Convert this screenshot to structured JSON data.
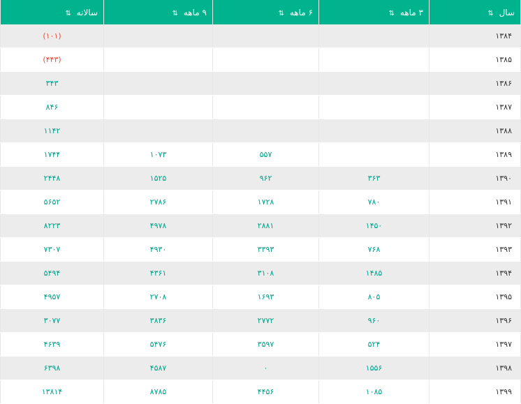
{
  "headers": {
    "annual": "سالانه",
    "nine_month": "۹ ماهه",
    "six_month": "۶ ماهه",
    "three_month": "۳ ماهه",
    "year": "سال",
    "sort_icon": "⇅",
    "sort_active_icon": "⇅"
  },
  "colors": {
    "header_bg": "#00b38f",
    "value_text": "#00a189",
    "negative_text": "#e74c3c",
    "row_alt_bg": "#ececec"
  },
  "rows": [
    {
      "year": "۱۳۸۴",
      "m3": "",
      "m6": "",
      "m9": "",
      "annual": "(۱۰۱)",
      "negative": true
    },
    {
      "year": "۱۳۸۵",
      "m3": "",
      "m6": "",
      "m9": "",
      "annual": "(۴۴۳)",
      "negative": true
    },
    {
      "year": "۱۳۸۶",
      "m3": "",
      "m6": "",
      "m9": "",
      "annual": "۳۴۳",
      "negative": false
    },
    {
      "year": "۱۳۸۷",
      "m3": "",
      "m6": "",
      "m9": "",
      "annual": "۸۴۶",
      "negative": false
    },
    {
      "year": "۱۳۸۸",
      "m3": "",
      "m6": "",
      "m9": "",
      "annual": "۱۱۴۲",
      "negative": false
    },
    {
      "year": "۱۳۸۹",
      "m3": "",
      "m6": "۵۵۷",
      "m9": "۱۰۷۳",
      "annual": "۱۷۴۴",
      "negative": false
    },
    {
      "year": "۱۳۹۰",
      "m3": "۳۶۳",
      "m6": "۹۶۲",
      "m9": "۱۵۲۵",
      "annual": "۲۴۴۸",
      "negative": false
    },
    {
      "year": "۱۳۹۱",
      "m3": "۷۸۰",
      "m6": "۱۷۲۸",
      "m9": "۲۷۸۶",
      "annual": "۵۶۵۲",
      "negative": false
    },
    {
      "year": "۱۳۹۲",
      "m3": "۱۴۵۰",
      "m6": "۲۸۸۱",
      "m9": "۴۹۷۸",
      "annual": "۸۲۲۳",
      "negative": false
    },
    {
      "year": "۱۳۹۳",
      "m3": "۷۶۸",
      "m6": "۳۳۹۳",
      "m9": "۴۹۳۰",
      "annual": "۷۳۰۷",
      "negative": false
    },
    {
      "year": "۱۳۹۴",
      "m3": "۱۴۸۵",
      "m6": "۳۱۰۸",
      "m9": "۴۳۶۱",
      "annual": "۵۴۹۴",
      "negative": false
    },
    {
      "year": "۱۳۹۵",
      "m3": "۸۰۵",
      "m6": "۱۶۹۳",
      "m9": "۲۷۰۸",
      "annual": "۴۹۵۷",
      "negative": false
    },
    {
      "year": "۱۳۹۶",
      "m3": "۹۶۰",
      "m6": "۲۷۷۲",
      "m9": "۳۸۳۶",
      "annual": "۳۰۷۷",
      "negative": false
    },
    {
      "year": "۱۳۹۷",
      "m3": "۵۲۴",
      "m6": "۳۵۹۷",
      "m9": "۵۴۷۶",
      "annual": "۴۶۳۹",
      "negative": false
    },
    {
      "year": "۱۳۹۸",
      "m3": "۱۵۵۶",
      "m6": "۰",
      "m9": "۴۵۸۷",
      "annual": "۶۳۹۸",
      "negative": false
    },
    {
      "year": "۱۳۹۹",
      "m3": "۱۰۸۵",
      "m6": "۴۴۵۶",
      "m9": "۸۷۸۵",
      "annual": "۱۳۸۱۴",
      "negative": false
    }
  ]
}
